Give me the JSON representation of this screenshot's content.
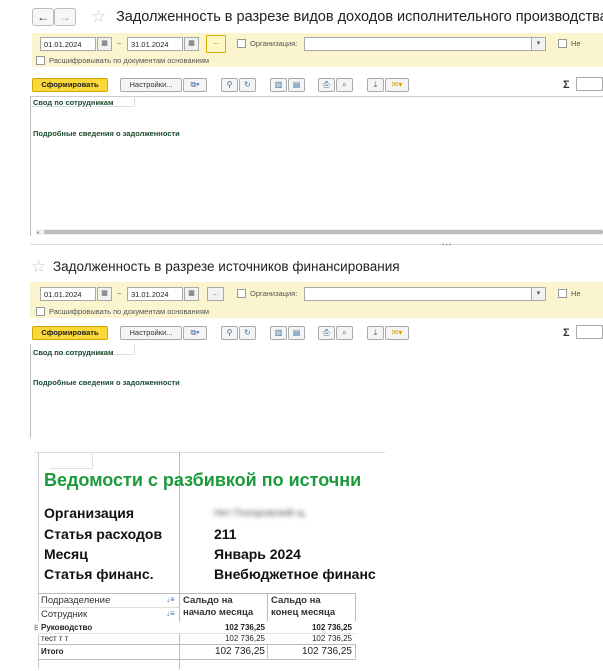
{
  "window1": {
    "title": "Задолженность в разрезе видов доходов исполнительного производства",
    "date_from": "01.01.2024",
    "dash": "–",
    "date_to": "31.01.2024",
    "ellipsis": "...",
    "org_label": "Организация:",
    "org_value": "",
    "not_label": "Не",
    "decode_label": "Расшифровывать по документам основаниям",
    "generate": "Сформировать",
    "settings": "Настройки...",
    "sigma": "Σ",
    "panel_top": "Свод по сотрудникам",
    "panel_bottom": "Подробные сведения о задолженности"
  },
  "window2": {
    "title": "Задолженность в разрезе источников финансирования",
    "date_from": "01.01.2024",
    "dash": "–",
    "date_to": "31.01.2024",
    "ellipsis": "...",
    "org_label": "Организация:",
    "org_value": "",
    "not_label": "Не",
    "decode_label": "Расшифровывать по документам основаниям",
    "generate": "Сформировать",
    "settings": "Настройки...",
    "sigma": "Σ",
    "panel_top": "Свод по сотрудникам",
    "panel_bottom": "Подробные сведения о задолженности"
  },
  "report": {
    "title": "Ведомости с разбивкой по источни",
    "fields": [
      {
        "label": "Организация",
        "value": "Нет Похоровский щ"
      },
      {
        "label": "Статья расходов",
        "value": "211"
      },
      {
        "label": "Месяц",
        "value": "Январь 2024"
      },
      {
        "label": "Статья финанс.",
        "value": "Внебюджетное финанс"
      }
    ],
    "group_header_1": "Подразделение",
    "group_header_2": "Сотрудник",
    "col1_line1": "Сальдо на",
    "col1_line2": "начало месяца",
    "col2_line1": "Сальдо на",
    "col2_line2": "конец месяца",
    "rows": [
      {
        "name": "Руководство",
        "start": "102 736,25",
        "end": "102 736,25"
      },
      {
        "name": "тест т т",
        "start": "102 736,25",
        "end": "102 736,25"
      },
      {
        "name": "Итого",
        "start": "102 736,25",
        "end": "102 736,25"
      }
    ]
  }
}
